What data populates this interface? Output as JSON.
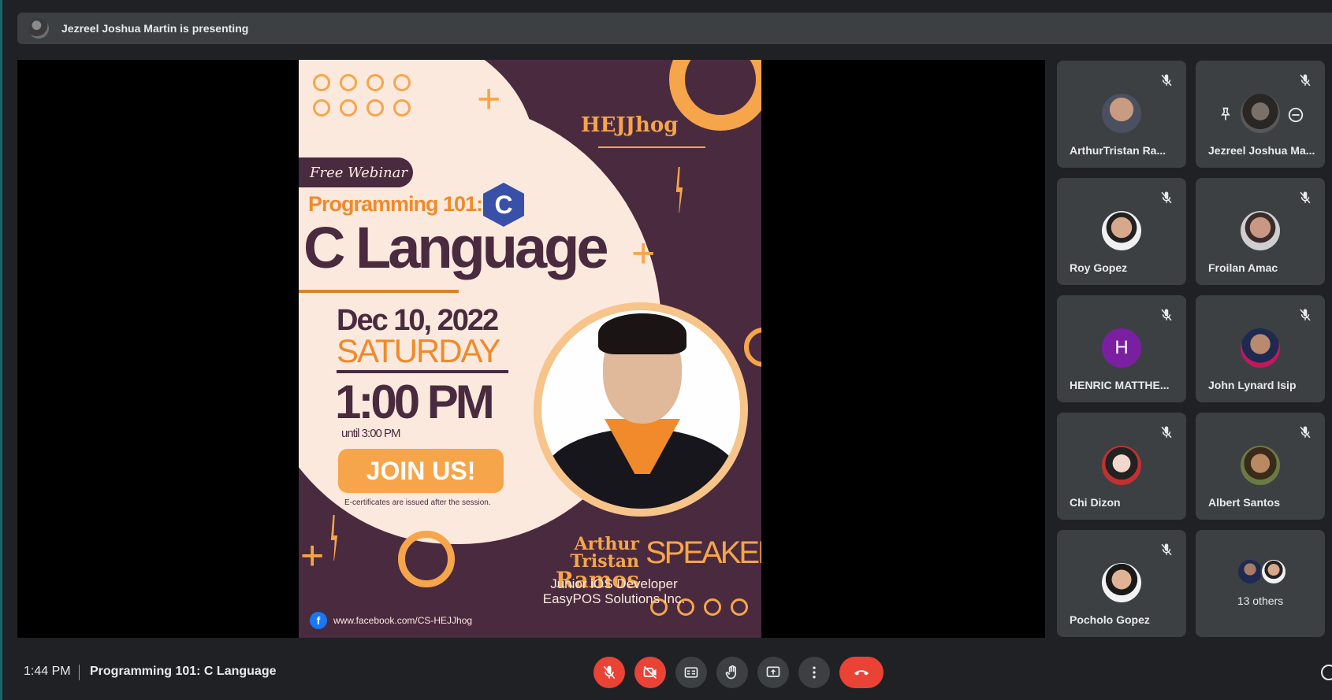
{
  "banner": {
    "presenter_text": "Jezreel Joshua Martin is presenting"
  },
  "poster": {
    "brand": "HEJJhog",
    "free_webinar": "Free Webinar",
    "programming": "Programming 101:",
    "c_logo": "C",
    "language": "C Language",
    "date": "Dec 10, 2022",
    "day": "SATURDAY",
    "time": "1:00 PM",
    "until": "until 3:00 PM",
    "join": "JOIN US!",
    "ecert": "E-certificates are issued after the session.",
    "speaker_first": "Arthur Tristan",
    "speaker_last": "Ramos",
    "speaker_label": "SPEAKER",
    "role_1": "Junior iOS Developer",
    "role_2": "EasyPOS Solutions Inc.",
    "facebook_url": "www.facebook.com/CS-HEJJhog",
    "facebook_icon": "f"
  },
  "participants": [
    {
      "name": "ArthurTristan Ra...",
      "avatar": "photo"
    },
    {
      "name": "Jezreel Joshua Ma...",
      "avatar": "photo"
    },
    {
      "name": "Roy Gopez",
      "avatar": "photo"
    },
    {
      "name": "Froilan Amac",
      "avatar": "photo"
    },
    {
      "name": "HENRIC MATTHE...",
      "avatar": "H"
    },
    {
      "name": "John Lynard Isip",
      "avatar": "photo"
    },
    {
      "name": "Chi Dizon",
      "avatar": "photo"
    },
    {
      "name": "Albert Santos",
      "avatar": "photo"
    },
    {
      "name": "Pocholo Gopez",
      "avatar": "photo"
    }
  ],
  "others": {
    "label": "13 others"
  },
  "bottom_bar": {
    "time": "1:44 PM",
    "meeting_title": "Programming 101: C Language",
    "controls": [
      "mic-off-icon",
      "camera-off-icon",
      "captions-icon",
      "raise-hand-icon",
      "present-icon",
      "more-options-icon",
      "hang-up-icon"
    ]
  },
  "colors": {
    "background": "#202124",
    "tile": "#3c4043",
    "red": "#ea4335",
    "poster_purple": "#4a2a3e",
    "poster_orange": "#f7a54a",
    "poster_cream": "#fbe9de"
  }
}
